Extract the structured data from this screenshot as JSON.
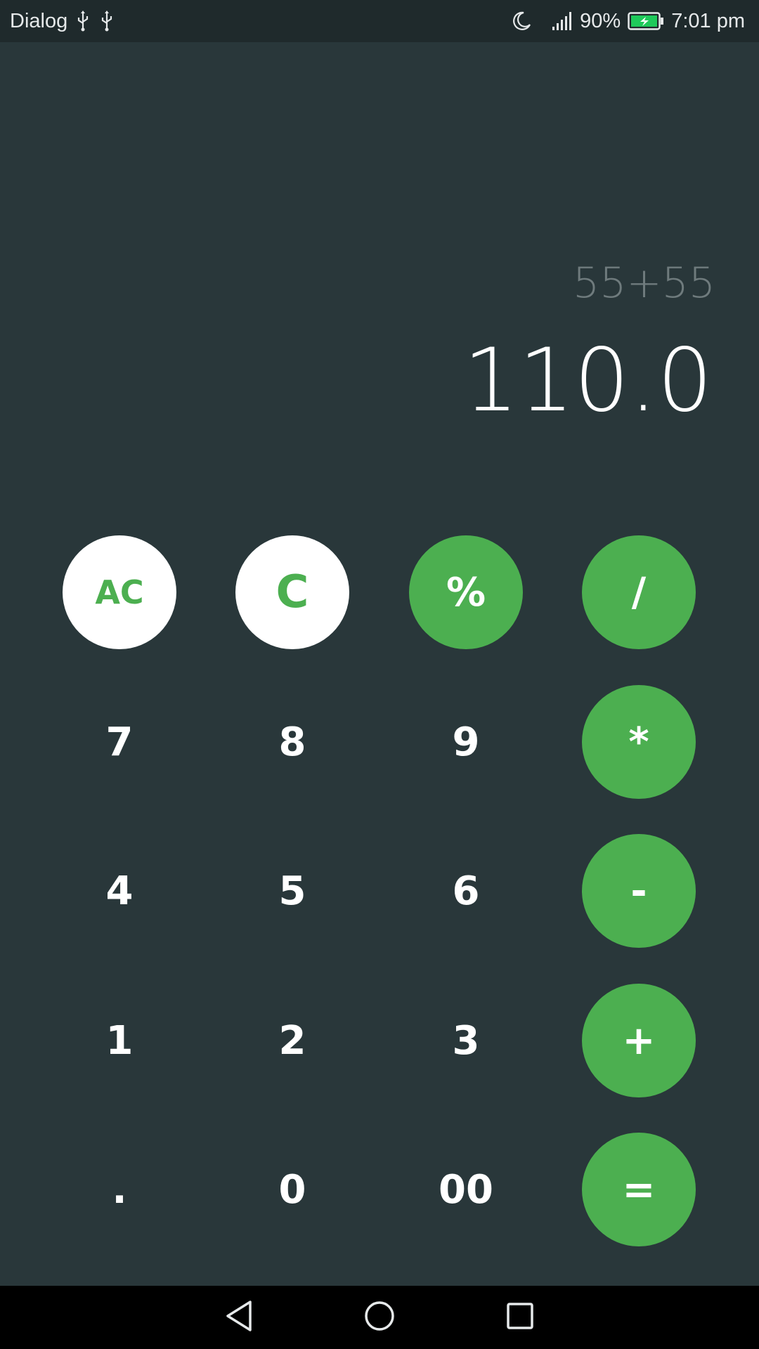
{
  "status_bar": {
    "carrier": "Dialog",
    "battery_percent": "90%",
    "time": "7:01 pm",
    "icons": [
      "usb-icon",
      "usb-icon",
      "moon-icon",
      "signal-icon",
      "battery-charging-icon"
    ]
  },
  "display": {
    "expression": "55+55",
    "result": "110.0"
  },
  "keys": {
    "ac": "AC",
    "c": "C",
    "percent": "%",
    "divide": "/",
    "seven": "7",
    "eight": "8",
    "nine": "9",
    "multiply": "*",
    "four": "4",
    "five": "5",
    "six": "6",
    "minus": "-",
    "one": "1",
    "two": "2",
    "three": "3",
    "plus": "+",
    "dot": ".",
    "zero": "0",
    "double_zero": "00",
    "equals": "="
  },
  "nav_bar": {
    "icons": [
      "back-icon",
      "home-icon",
      "recents-icon"
    ]
  },
  "colors": {
    "background": "#29373a",
    "accent": "#4caf50",
    "status_bar": "#1f2a2c",
    "nav_bar": "#000000"
  }
}
